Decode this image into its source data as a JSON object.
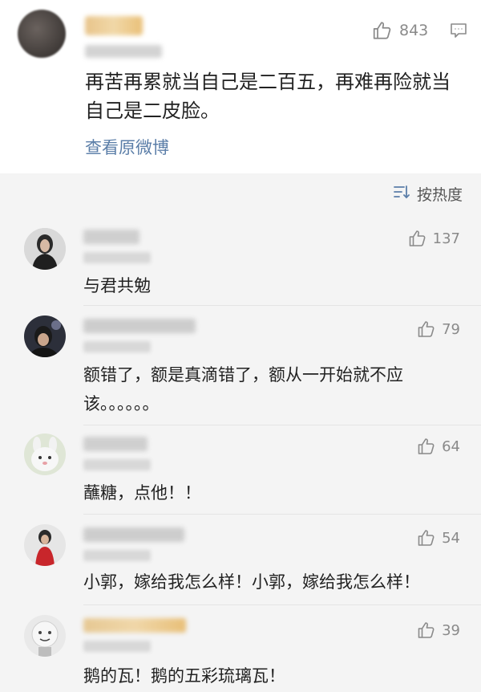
{
  "post": {
    "like_count": "843",
    "text_line1": "再苦再累就当自己是二百五，再难再险就当",
    "text_line2": "自己是二皮脸。",
    "view_original": "查看原微博"
  },
  "sort": {
    "label": "按热度"
  },
  "comments": [
    {
      "likes": "137",
      "text": "与君共勉"
    },
    {
      "likes": "79",
      "text_line1": "额错了，额是真滴错了，额从一开始就不应",
      "text_line2": "该。。。。。。"
    },
    {
      "likes": "64",
      "text": "蘸糖，点他！！"
    },
    {
      "likes": "54",
      "text": "小郭，嫁给我怎么样！小郭，嫁给我怎么样！"
    },
    {
      "likes": "39",
      "text": "鹅的瓦！鹅的五彩琉璃瓦！"
    }
  ],
  "colors": {
    "link": "#5b7ea8",
    "icon": "#8a8a8a",
    "background": "#f4f4f4"
  }
}
